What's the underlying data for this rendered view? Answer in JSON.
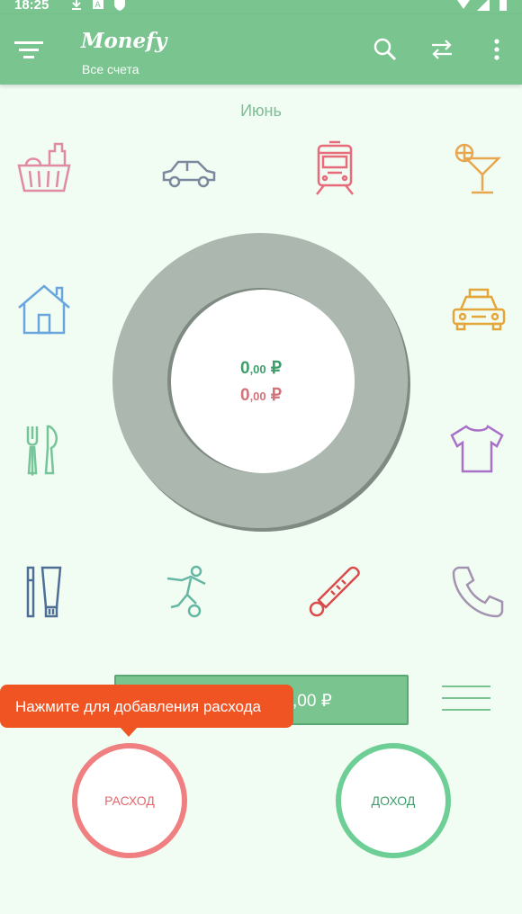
{
  "status_bar": {
    "time": "18:25"
  },
  "app_bar": {
    "title": "Monefy",
    "subtitle": "Все счета",
    "icons": [
      "menu-icon",
      "search-icon",
      "transfer-icon",
      "more-vert-icon"
    ]
  },
  "month_label": "Июнь",
  "categories": [
    {
      "name": "groceries",
      "icon": "basket-icon",
      "color": "#e08aa5"
    },
    {
      "name": "car",
      "icon": "car-icon",
      "color": "#7b889d"
    },
    {
      "name": "transport",
      "icon": "train-icon",
      "color": "#e86b7c"
    },
    {
      "name": "entertainment",
      "icon": "cocktail-icon",
      "color": "#e7a64f"
    },
    {
      "name": "house",
      "icon": "house-icon",
      "color": "#6aa6dd"
    },
    {
      "name": "taxi",
      "icon": "taxi-icon",
      "color": "#e4a63b"
    },
    {
      "name": "eating-out",
      "icon": "cutlery-icon",
      "color": "#76c59a"
    },
    {
      "name": "clothes",
      "icon": "tshirt-icon",
      "color": "#a970c8"
    },
    {
      "name": "toiletry",
      "icon": "toiletry-icon",
      "color": "#4f6e95"
    },
    {
      "name": "sports",
      "icon": "soccer-icon",
      "color": "#65b7a4"
    },
    {
      "name": "health",
      "icon": "thermometer-icon",
      "color": "#d94b4b"
    },
    {
      "name": "communications",
      "icon": "phone-icon",
      "color": "#a392b0"
    }
  ],
  "summary": {
    "income_int": "0",
    "income_dec": ",00",
    "expense_int": "0",
    "expense_dec": ",00",
    "currency": "₽"
  },
  "balance": {
    "text": ",00 ₽"
  },
  "tooltip": {
    "text": "Нажмите для добавления расхода"
  },
  "buttons": {
    "expense_label": "РАСХОД",
    "income_label": "ДОХОД"
  },
  "colors": {
    "primary": "#79c48f",
    "background": "#f1fdf2",
    "donut": "#acb8af",
    "expense": "#ef7f80",
    "income": "#6dcf95",
    "tooltip": "#f05423"
  }
}
